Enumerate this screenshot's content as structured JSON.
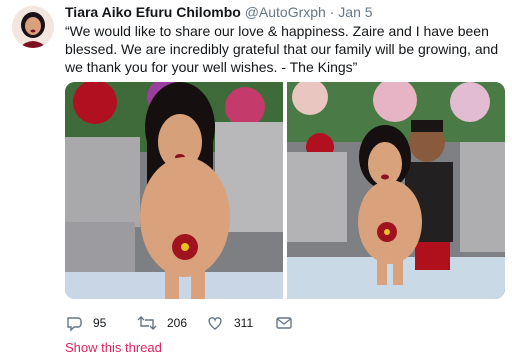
{
  "tweet": {
    "display_name": "Tiara Aiko Efuru Chilombo",
    "handle": "@AutoGrxph",
    "separator": "·",
    "date": "Jan 5",
    "text": "“We would like to share our love & happiness. Zaire and I have been blessed. We are incredibly grateful that our family will be growing, and we thank you for your well wishes. - The Kings”"
  },
  "actions": {
    "replies": {
      "icon": "reply-icon",
      "count": "95"
    },
    "retweets": {
      "icon": "retweet-icon",
      "count": "206"
    },
    "likes": {
      "icon": "heart-icon",
      "count": "311"
    },
    "message": {
      "icon": "envelope-icon"
    }
  },
  "show_thread_label": "Show this thread",
  "colors": {
    "text": "#14171a",
    "secondary": "#657786",
    "accent_link": "#e0245e"
  }
}
